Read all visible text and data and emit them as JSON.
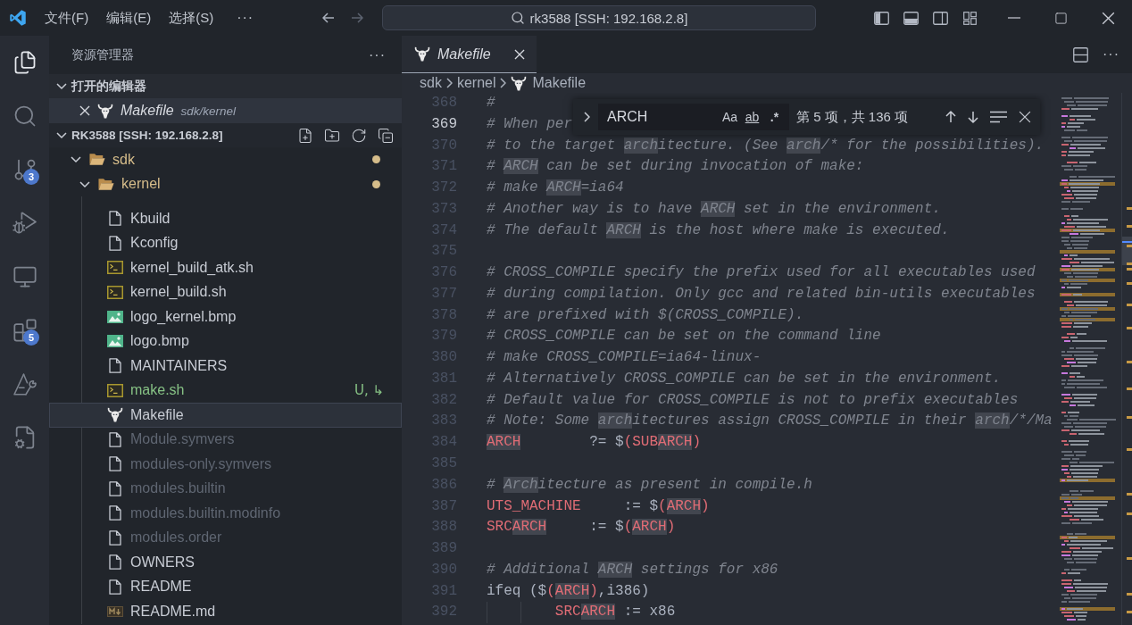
{
  "title_bar": {
    "menus": [
      "文件(F)",
      "编辑(E)",
      "选择(S)"
    ],
    "more": "···",
    "nav_buttons": [
      {
        "kind": "back",
        "disabled": false
      },
      {
        "kind": "forward",
        "disabled": true
      }
    ],
    "command_center": "rk3588 [SSH: 192.168.2.8]",
    "layout_toggles": [
      {
        "kind": "primary_sidebar",
        "on": true
      },
      {
        "kind": "panel",
        "on": true
      },
      {
        "kind": "secondary_sidebar",
        "on": false
      },
      {
        "kind": "customize_layout"
      }
    ]
  },
  "activity_bar": [
    {
      "kind": "explorer",
      "selected": true
    },
    {
      "kind": "search",
      "selected": false
    },
    {
      "kind": "source_control",
      "selected": false,
      "badge": "3"
    },
    {
      "kind": "run_debug",
      "selected": false
    },
    {
      "kind": "remote_explorer",
      "selected": false
    },
    {
      "kind": "extensions",
      "selected": false,
      "badge": "5"
    },
    {
      "kind": "tool",
      "selected": false
    },
    {
      "kind": "cpp_config",
      "selected": false
    }
  ],
  "sidebar": {
    "title": "资源管理器",
    "more": "···",
    "sections": [
      {
        "kind": "open_editors",
        "title": "打开的编辑器",
        "expanded": true,
        "items": [
          {
            "name": "Makefile",
            "description": "sdk/kernel",
            "kind": "makefile",
            "preview": true,
            "selected": true
          }
        ]
      },
      {
        "kind": "folder",
        "title": "RK3588 [SSH: 192.168.2.8]",
        "expanded": true,
        "tree": [
          {
            "name": "sdk",
            "kind": "folder",
            "expanded": true,
            "color": "#d5bc8a",
            "selected": false,
            "children": [
              {
                "name": "kernel",
                "kind": "folder",
                "expanded": true,
                "color": "#d5bc8a",
                "selected": false,
                "children": [
                  {
                    "name": "Kbuild",
                    "kind": "file",
                    "selected": false
                  },
                  {
                    "name": "Kconfig",
                    "kind": "file",
                    "selected": false
                  },
                  {
                    "name": "kernel_build_atk.sh",
                    "kind": "shell",
                    "selected": false
                  },
                  {
                    "name": "kernel_build.sh",
                    "kind": "shell",
                    "selected": false
                  },
                  {
                    "name": "logo_kernel.bmp",
                    "kind": "image",
                    "selected": false
                  },
                  {
                    "name": "logo.bmp",
                    "kind": "image",
                    "selected": false
                  },
                  {
                    "name": "MAINTAINERS",
                    "kind": "file",
                    "selected": false
                  },
                  {
                    "name": "make.sh",
                    "kind": "shell",
                    "color": "#86c184",
                    "decoration": "U, ↳",
                    "selected": false
                  },
                  {
                    "name": "Makefile",
                    "kind": "makefile",
                    "selected": true
                  },
                  {
                    "name": "Module.symvers",
                    "kind": "file",
                    "color": "#5f6672",
                    "selected": false
                  },
                  {
                    "name": "modules-only.symvers",
                    "kind": "file",
                    "color": "#5f6672",
                    "selected": false
                  },
                  {
                    "name": "modules.builtin",
                    "kind": "file",
                    "color": "#5f6672",
                    "selected": false
                  },
                  {
                    "name": "modules.builtin.modinfo",
                    "kind": "file",
                    "color": "#5f6672",
                    "selected": false
                  },
                  {
                    "name": "modules.order",
                    "kind": "file",
                    "color": "#5f6672",
                    "selected": false
                  },
                  {
                    "name": "OWNERS",
                    "kind": "file",
                    "selected": false
                  },
                  {
                    "name": "README",
                    "kind": "file",
                    "selected": false
                  },
                  {
                    "name": "README.md",
                    "kind": "markdown",
                    "selected": false
                  }
                ]
              }
            ]
          }
        ]
      }
    ]
  },
  "editor": {
    "tabs": [
      {
        "label": "Makefile",
        "kind": "makefile",
        "preview": true,
        "selected": true
      }
    ],
    "more": "···",
    "breadcrumbs": [
      {
        "label": "sdk",
        "kind": "folder"
      },
      {
        "label": "kernel",
        "kind": "folder"
      },
      {
        "label": "Makefile",
        "kind": "makefile"
      }
    ],
    "find": {
      "replace_expanded": false,
      "query": "ARCH",
      "options": [
        {
          "kind": "match_case",
          "label": "Aa",
          "on": false
        },
        {
          "kind": "whole_word",
          "label": "ab",
          "on": false
        },
        {
          "kind": "regex",
          "label": ".*",
          "on": false
        }
      ],
      "result": "第 5 项，共 136 项"
    },
    "lines": [
      {
        "number": "368",
        "current": false,
        "tokens": [
          {
            "text": "#",
            "kind": "comment",
            "match": false
          }
        ]
      },
      {
        "number": "369",
        "current": true,
        "tokens": [
          {
            "text": "# When per",
            "kind": "comment",
            "match": false
          }
        ]
      },
      {
        "number": "370",
        "current": false,
        "tokens": [
          {
            "text": "# to the target ",
            "kind": "comment",
            "match": false
          },
          {
            "text": "arch",
            "kind": "comment",
            "match": true
          },
          {
            "text": "itecture. (See ",
            "kind": "comment",
            "match": false
          },
          {
            "text": "arch",
            "kind": "comment",
            "match": true
          },
          {
            "text": "/* for the possibilities).",
            "kind": "comment",
            "match": false
          }
        ]
      },
      {
        "number": "371",
        "current": false,
        "tokens": [
          {
            "text": "# ",
            "kind": "comment",
            "match": false
          },
          {
            "text": "ARCH",
            "kind": "comment",
            "match": true
          },
          {
            "text": " can be set during invocation of make:",
            "kind": "comment",
            "match": false
          }
        ]
      },
      {
        "number": "372",
        "current": false,
        "tokens": [
          {
            "text": "# make ",
            "kind": "comment",
            "match": false
          },
          {
            "text": "ARCH",
            "kind": "comment",
            "match": true
          },
          {
            "text": "=ia64",
            "kind": "comment",
            "match": false
          }
        ]
      },
      {
        "number": "373",
        "current": false,
        "tokens": [
          {
            "text": "# Another way is to have ",
            "kind": "comment",
            "match": false
          },
          {
            "text": "ARCH",
            "kind": "comment",
            "match": true
          },
          {
            "text": " set in the environment.",
            "kind": "comment",
            "match": false
          }
        ]
      },
      {
        "number": "374",
        "current": false,
        "tokens": [
          {
            "text": "# The default ",
            "kind": "comment",
            "match": false
          },
          {
            "text": "ARCH",
            "kind": "comment",
            "match": true
          },
          {
            "text": " is the host where make is executed.",
            "kind": "comment",
            "match": false
          }
        ]
      },
      {
        "number": "375",
        "current": false
      },
      {
        "number": "376",
        "current": false,
        "tokens": [
          {
            "text": "# CROSS_COMPILE specify the prefix used for all executables used",
            "kind": "comment",
            "match": false
          }
        ]
      },
      {
        "number": "377",
        "current": false,
        "tokens": [
          {
            "text": "# during compilation. Only gcc and related bin-utils executables",
            "kind": "comment",
            "match": false
          }
        ]
      },
      {
        "number": "378",
        "current": false,
        "tokens": [
          {
            "text": "# are prefixed with $(CROSS_COMPILE).",
            "kind": "comment",
            "match": false
          }
        ]
      },
      {
        "number": "379",
        "current": false,
        "tokens": [
          {
            "text": "# CROSS_COMPILE can be set on the command line",
            "kind": "comment",
            "match": false
          }
        ]
      },
      {
        "number": "380",
        "current": false,
        "tokens": [
          {
            "text": "# make CROSS_COMPILE=ia64-linux-",
            "kind": "comment",
            "match": false
          }
        ]
      },
      {
        "number": "381",
        "current": false,
        "tokens": [
          {
            "text": "# Alternatively CROSS_COMPILE can be set in the environment.",
            "kind": "comment",
            "match": false
          }
        ]
      },
      {
        "number": "382",
        "current": false,
        "tokens": [
          {
            "text": "# Default value for CROSS_COMPILE is not to prefix executables",
            "kind": "comment",
            "match": false
          }
        ]
      },
      {
        "number": "383",
        "current": false,
        "tokens": [
          {
            "text": "# Note: Some ",
            "kind": "comment",
            "match": false
          },
          {
            "text": "arch",
            "kind": "comment",
            "match": true
          },
          {
            "text": "itectures assign CROSS_COMPILE in their ",
            "kind": "comment",
            "match": false
          },
          {
            "text": "arch",
            "kind": "comment",
            "match": true
          },
          {
            "text": "/*/Ma",
            "kind": "comment",
            "match": false
          }
        ]
      },
      {
        "number": "384",
        "current": false,
        "tokens": [
          {
            "text": "ARCH",
            "kind": "variable",
            "match": true
          },
          {
            "text": "        ?= $",
            "kind": "plain",
            "match": false
          },
          {
            "text": "(SUB",
            "kind": "variable",
            "match": false
          },
          {
            "text": "ARCH",
            "kind": "variable",
            "match": true
          },
          {
            "text": ")",
            "kind": "variable",
            "match": false
          }
        ]
      },
      {
        "number": "385",
        "current": false
      },
      {
        "number": "386",
        "current": false,
        "tokens": [
          {
            "text": "# ",
            "kind": "comment",
            "match": false
          },
          {
            "text": "Arch",
            "kind": "comment",
            "match": true
          },
          {
            "text": "itecture as present in compile.h",
            "kind": "comment",
            "match": false
          }
        ]
      },
      {
        "number": "387",
        "current": false,
        "tokens": [
          {
            "text": "UTS_MACHINE",
            "kind": "variable",
            "match": false
          },
          {
            "text": "     := $",
            "kind": "plain",
            "match": false
          },
          {
            "text": "(",
            "kind": "variable",
            "match": false
          },
          {
            "text": "ARCH",
            "kind": "variable",
            "match": true
          },
          {
            "text": ")",
            "kind": "variable",
            "match": false
          }
        ]
      },
      {
        "number": "388",
        "current": false,
        "tokens": [
          {
            "text": "SRC",
            "kind": "variable",
            "match": false
          },
          {
            "text": "ARCH",
            "kind": "variable",
            "match": true
          },
          {
            "text": "     := $",
            "kind": "plain",
            "match": false
          },
          {
            "text": "(",
            "kind": "variable",
            "match": false
          },
          {
            "text": "ARCH",
            "kind": "variable",
            "match": true
          },
          {
            "text": ")",
            "kind": "variable",
            "match": false
          }
        ]
      },
      {
        "number": "389",
        "current": false
      },
      {
        "number": "390",
        "current": false,
        "tokens": [
          {
            "text": "# Additional ",
            "kind": "comment",
            "match": false
          },
          {
            "text": "ARCH",
            "kind": "comment",
            "match": true
          },
          {
            "text": " settings for x86",
            "kind": "comment",
            "match": false
          }
        ]
      },
      {
        "number": "391",
        "current": false,
        "tokens": [
          {
            "text": "ifeq ($",
            "kind": "plain",
            "match": false
          },
          {
            "text": "(",
            "kind": "variable",
            "match": false
          },
          {
            "text": "ARCH",
            "kind": "variable",
            "match": true
          },
          {
            "text": ")",
            "kind": "variable",
            "match": false
          },
          {
            "text": ",i386)",
            "kind": "plain",
            "match": false
          }
        ]
      },
      {
        "number": "392",
        "current": false,
        "indented": true,
        "tokens": [
          {
            "text": "SRC",
            "kind": "variable",
            "match": false
          },
          {
            "text": "ARCH",
            "kind": "variable",
            "match": true
          },
          {
            "text": " := x86",
            "kind": "plain",
            "match": false
          }
        ]
      }
    ]
  }
}
